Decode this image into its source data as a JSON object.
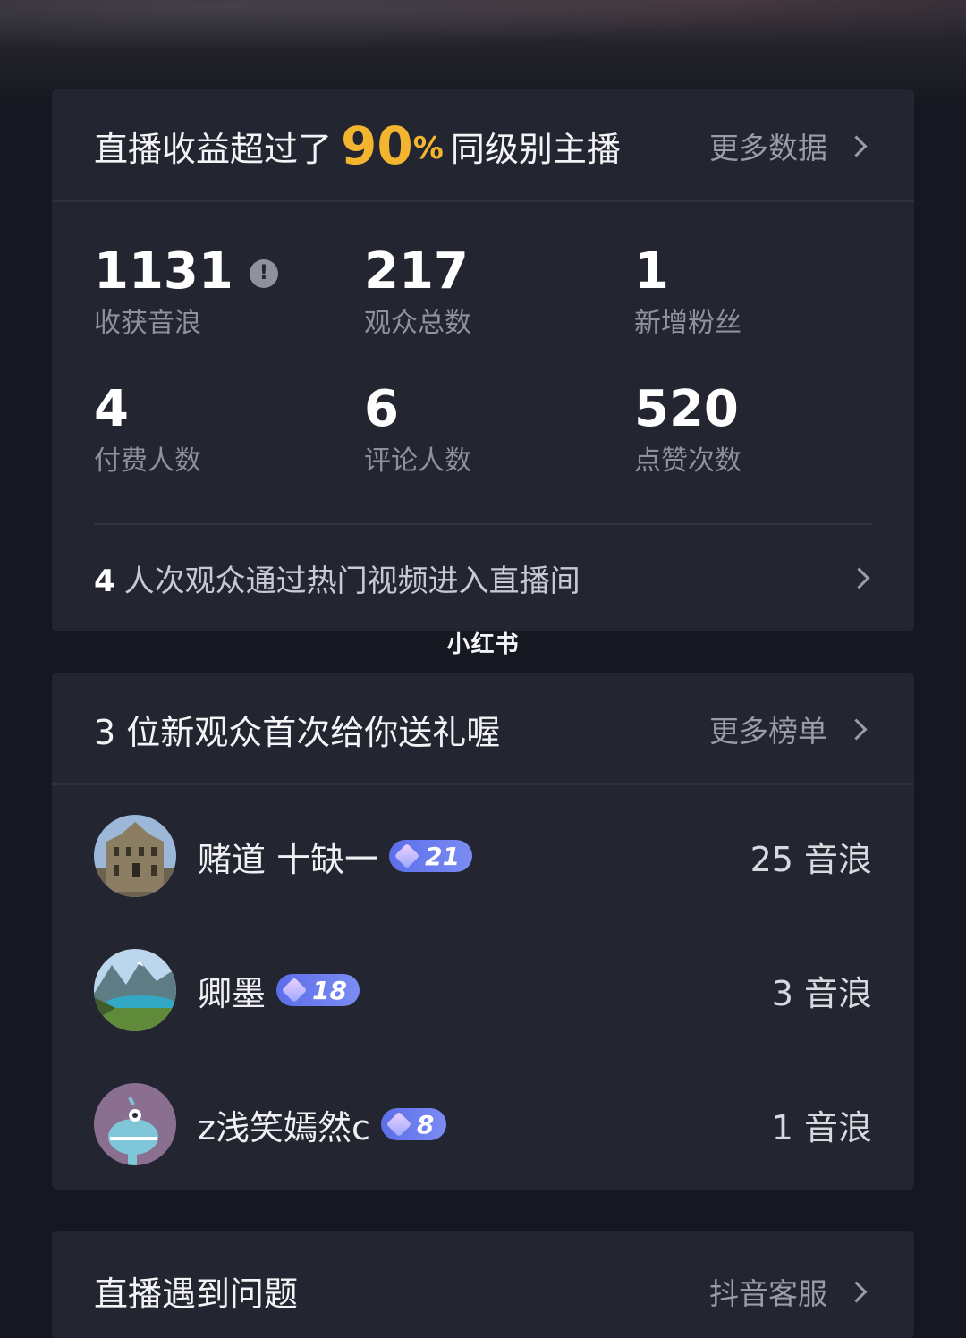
{
  "summary": {
    "title_prefix": "直播收益超过了",
    "percent": "90",
    "percent_symbol": "%",
    "title_suffix": "同级别主播",
    "more_link": "更多数据"
  },
  "stats": [
    {
      "value": "1131",
      "label": "收获音浪"
    },
    {
      "value": "217",
      "label": "观众总数"
    },
    {
      "value": "1",
      "label": "新增粉丝"
    },
    {
      "value": "4",
      "label": "付费人数"
    },
    {
      "value": "6",
      "label": "评论人数"
    },
    {
      "value": "520",
      "label": "点赞次数"
    }
  ],
  "info_icon_glyph": "!",
  "hot_video": {
    "count": "4",
    "text": "人次观众通过热门视频进入直播间"
  },
  "watermark": "小红书",
  "gifts": {
    "title": "3 位新观众首次给你送礼喔",
    "more_link": "更多榜单",
    "items": [
      {
        "name": "赌道 十缺一",
        "level": "21",
        "amount": "25 音浪"
      },
      {
        "name": "卿墨",
        "level": "18",
        "amount": "3 音浪"
      },
      {
        "name": "z浅笑嫣然c",
        "level": "8",
        "amount": "1 音浪"
      }
    ]
  },
  "problems": {
    "title": "直播遇到问题",
    "link": "抖音客服"
  },
  "colors": {
    "background": "#161821",
    "card": "#232531",
    "accent_gold": "#f3b52f",
    "badge_blue": "#5c6ee8"
  }
}
